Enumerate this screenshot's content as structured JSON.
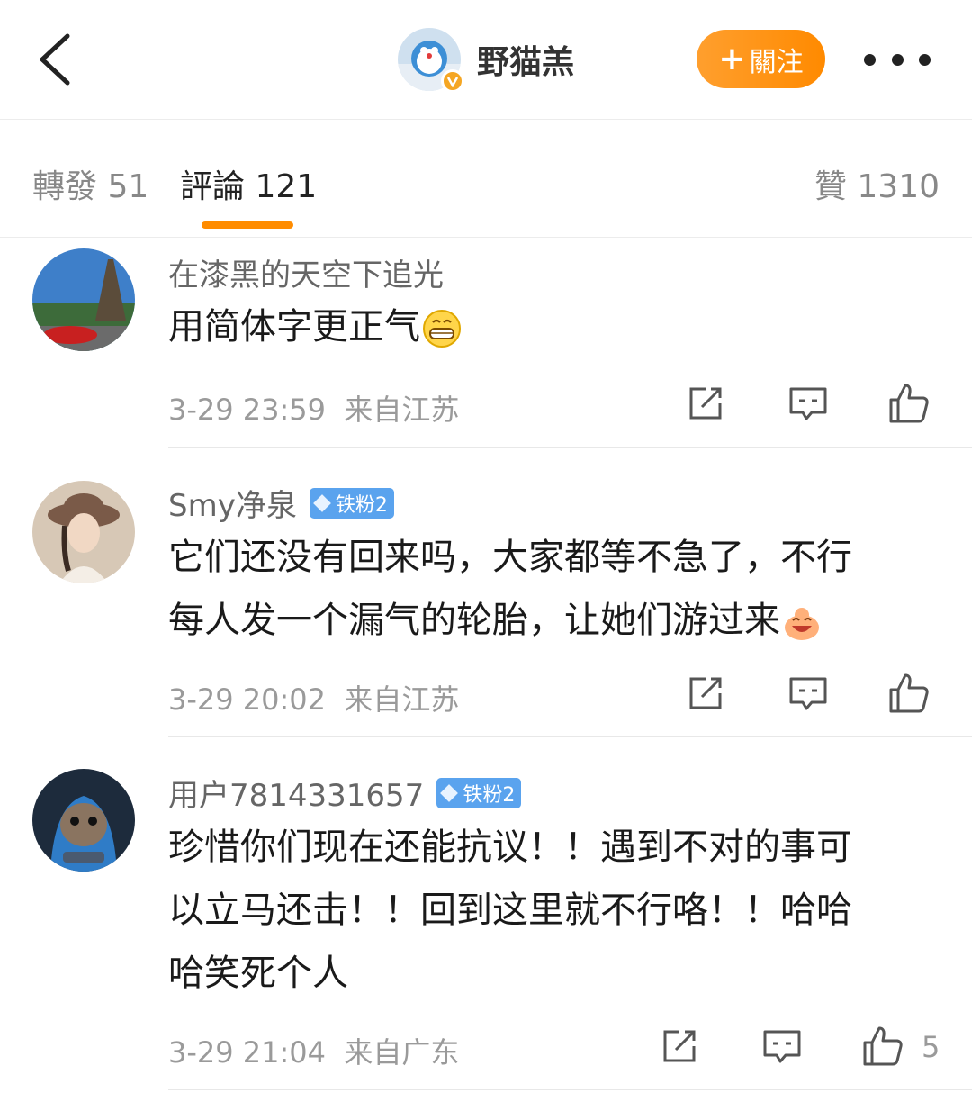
{
  "header": {
    "username": "野猫羔",
    "follow_label": "關注"
  },
  "tabs": {
    "repost": "轉發 51",
    "comments": "評論 121",
    "likes": "贊 1310"
  },
  "comments": [
    {
      "name": "在漆黑的天空下追光",
      "badge": "",
      "lines": [
        "用简体字更正气"
      ],
      "time": "3-29 23:59",
      "location": "来自江苏",
      "likes": ""
    },
    {
      "name": "Smy净泉",
      "badge": "铁粉2",
      "lines": [
        "它们还没有回来吗，大家都等不急了，不行",
        "每人发一个漏气的轮胎，让她们游过来"
      ],
      "time": "3-29 20:02",
      "location": "来自江苏",
      "likes": ""
    },
    {
      "name": "用户7814331657",
      "badge": "铁粉2",
      "lines": [
        "珍惜你们现在还能抗议！！遇到不对的事可",
        "以立马还击！！回到这里就不行咯！！哈哈",
        "哈笑死个人"
      ],
      "time": "3-29 21:04",
      "location": "来自广东",
      "likes": "5"
    }
  ],
  "colors": {
    "accent": "#ff8c00",
    "fan_badge": "#5aa3ee"
  },
  "icons": [
    "back-arrow-icon",
    "verified-icon",
    "more-icon",
    "repost-icon",
    "comment-icon",
    "like-icon"
  ]
}
